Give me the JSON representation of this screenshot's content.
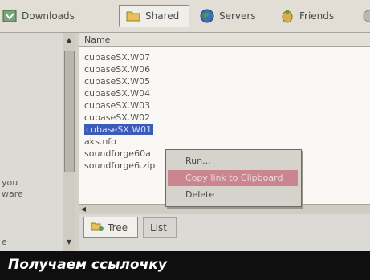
{
  "toolbar": {
    "tabs": [
      {
        "label": "Downloads",
        "icon": "downloads-icon"
      },
      {
        "label": "Shared",
        "icon": "folder-icon"
      },
      {
        "label": "Servers",
        "icon": "globe-icon"
      },
      {
        "label": "Friends",
        "icon": "friends-icon"
      }
    ],
    "active_tab": "Shared"
  },
  "left_panel": {
    "text_lines": [
      "you",
      "ware",
      "e"
    ]
  },
  "file_list": {
    "column_header": "Name",
    "rows": [
      "cubaseSX.W07",
      "cubaseSX.W06",
      "cubaseSX.W05",
      "cubaseSX.W04",
      "cubaseSX.W03",
      "cubaseSX.W02",
      "cubaseSX.W01",
      "aks.nfo",
      "soundforge60a",
      "soundforge6.zip"
    ],
    "selected_index": 6
  },
  "context_menu": {
    "items": [
      "Run...",
      "Copy link to Clipboard",
      "Delete"
    ],
    "highlighted_index": 1
  },
  "bottom_tabs": {
    "tabs": [
      "Tree",
      "List"
    ],
    "active": "Tree"
  },
  "caption": "Получаем ссылочку",
  "colors": {
    "selection": "#3a5bb8",
    "menu_highlight": "#c9868e",
    "caption_bg": "#0f0f0f"
  }
}
